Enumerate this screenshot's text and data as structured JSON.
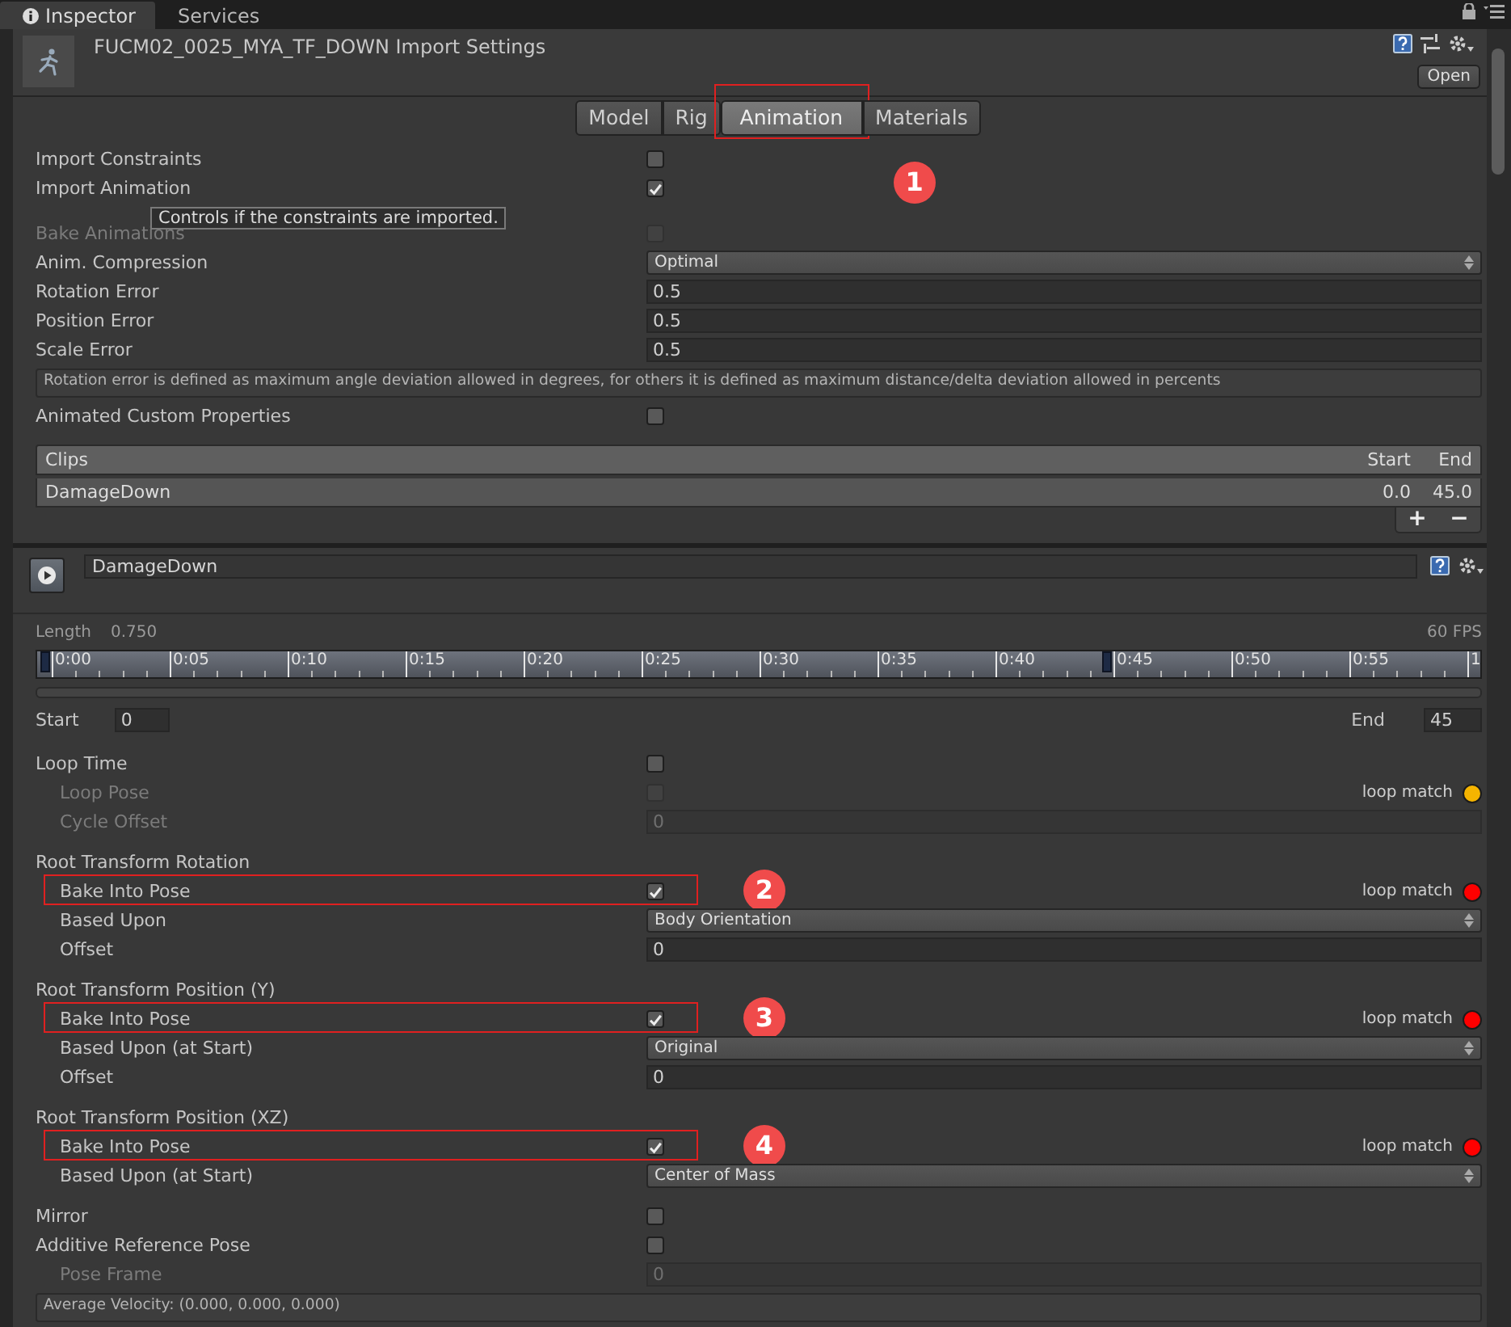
{
  "inspector_tabs": [
    {
      "label": "Inspector",
      "selected": true
    },
    {
      "label": "Services",
      "selected": false
    }
  ],
  "header": {
    "title": "FUCM02_0025_MYA_TF_DOWN Import Settings",
    "open_button": "Open"
  },
  "mode_tabs": [
    {
      "label": "Model",
      "selected": false,
      "highlighted": false
    },
    {
      "label": "Rig",
      "selected": false,
      "highlighted": false
    },
    {
      "label": "Animation",
      "selected": true,
      "highlighted": true,
      "callout": "1"
    },
    {
      "label": "Materials",
      "selected": false,
      "highlighted": false
    }
  ],
  "tooltip": {
    "text": "Controls if the constraints are imported."
  },
  "import_groups": [
    [
      {
        "kind": "checkbox",
        "label": "Import Constraints",
        "checked": false,
        "disabled": false
      },
      {
        "kind": "checkbox",
        "label": "Import Animation",
        "checked": true,
        "disabled": false
      }
    ],
    [
      {
        "kind": "checkbox",
        "label": "Bake Animations",
        "checked": false,
        "disabled": true
      },
      {
        "kind": "dropdown",
        "label": "Anim. Compression",
        "value": "Optimal"
      },
      {
        "kind": "field",
        "label": "Rotation Error",
        "value": "0.5",
        "disabled": false
      },
      {
        "kind": "field",
        "label": "Position Error",
        "value": "0.5",
        "disabled": false
      },
      {
        "kind": "field",
        "label": "Scale Error",
        "value": "0.5",
        "disabled": false
      },
      {
        "kind": "note",
        "text": "Rotation error is defined as maximum angle deviation allowed in degrees, for others it is defined as maximum distance/delta deviation allowed in percents"
      },
      {
        "kind": "checkbox",
        "label": "Animated Custom Properties",
        "checked": false,
        "disabled": false
      }
    ]
  ],
  "clips": {
    "columns": [
      "Clips",
      "Start",
      "End"
    ],
    "rows": [
      {
        "name": "DamageDown",
        "start": "0.0",
        "end": "45.0"
      }
    ],
    "add_button": "+",
    "remove_button": "−"
  },
  "clip": {
    "name": "DamageDown"
  },
  "timeline": {
    "length_label": "Length",
    "length": "0.750",
    "fps": "60 FPS",
    "labels": [
      "0:00",
      "0:05",
      "0:10",
      "0:15",
      "0:20",
      "0:25",
      "0:30",
      "0:35",
      "0:40",
      "0:45",
      "0:50",
      "0:55",
      "1"
    ],
    "start_marker": {
      "level": 0
    },
    "end_marker": {
      "level": 0.75
    }
  },
  "range": {
    "start_label": "Start",
    "start": "0",
    "end_label": "End",
    "end": "45"
  },
  "clip_groups": [
    [
      {
        "kind": "checkbox",
        "label": "Loop Time",
        "checked": false,
        "disabled": false,
        "children": [
          {
            "kind": "checkbox",
            "label": "Loop Pose",
            "checked": false,
            "disabled": true,
            "loop_match": {
              "text": "loop match",
              "color": "#f5b400"
            }
          },
          {
            "kind": "field",
            "label": "Cycle Offset",
            "value": "0",
            "disabled": true
          }
        ]
      }
    ],
    [
      {
        "kind": "heading",
        "label": "Root Transform Rotation",
        "children": [
          {
            "kind": "checkbox",
            "label": "Bake Into Pose",
            "checked": true,
            "disabled": false,
            "highlighted": true,
            "callout": "2",
            "loop_match": {
              "text": "loop match",
              "color": "#ff0000"
            }
          },
          {
            "kind": "dropdown",
            "label": "Based Upon",
            "value": "Body Orientation"
          },
          {
            "kind": "field",
            "label": "Offset",
            "value": "0",
            "disabled": false
          }
        ]
      }
    ],
    [
      {
        "kind": "heading",
        "label": "Root Transform Position (Y)",
        "children": [
          {
            "kind": "checkbox",
            "label": "Bake Into Pose",
            "checked": true,
            "disabled": false,
            "highlighted": true,
            "callout": "3",
            "loop_match": {
              "text": "loop match",
              "color": "#ff0000"
            }
          },
          {
            "kind": "dropdown",
            "label": "Based Upon (at Start)",
            "value": "Original"
          },
          {
            "kind": "field",
            "label": "Offset",
            "value": "0",
            "disabled": false
          }
        ]
      }
    ],
    [
      {
        "kind": "heading",
        "label": "Root Transform Position (XZ)",
        "children": [
          {
            "kind": "checkbox",
            "label": "Bake Into Pose",
            "checked": true,
            "disabled": false,
            "highlighted": true,
            "callout": "4",
            "loop_match": {
              "text": "loop match",
              "color": "#ff0000"
            }
          },
          {
            "kind": "dropdown",
            "label": "Based Upon (at Start)",
            "value": "Center of Mass"
          }
        ]
      }
    ],
    [
      {
        "kind": "checkbox",
        "label": "Mirror",
        "checked": false,
        "disabled": false
      },
      {
        "kind": "checkbox",
        "label": "Additive Reference Pose",
        "checked": false,
        "disabled": false,
        "children": [
          {
            "kind": "field",
            "label": "Pose Frame",
            "value": "0",
            "disabled": true
          }
        ]
      },
      {
        "kind": "note",
        "text": "Average Velocity: (0.000, 0.000, 0.000)"
      }
    ]
  ]
}
